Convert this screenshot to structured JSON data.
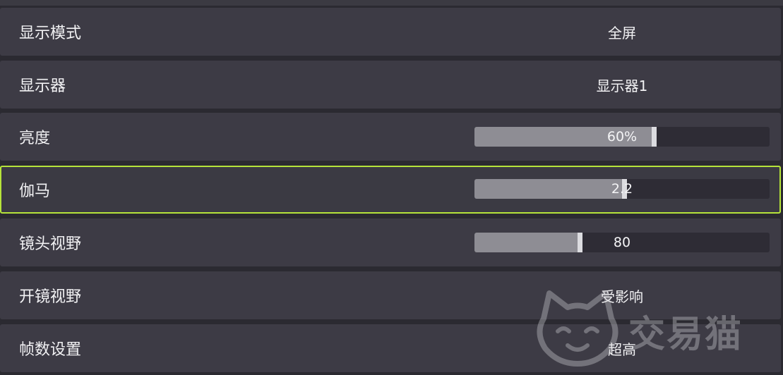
{
  "settings": [
    {
      "label": "显示模式",
      "type": "select",
      "value": "全屏"
    },
    {
      "label": "显示器",
      "type": "select",
      "value": "显示器1"
    },
    {
      "label": "亮度",
      "type": "slider",
      "value": "60%",
      "fraction": 0.6
    },
    {
      "label": "伽马",
      "type": "slider",
      "value": "2.2",
      "fraction": 0.5,
      "selected": true
    },
    {
      "label": "镜头视野",
      "type": "slider",
      "value": "80",
      "fraction": 0.35
    },
    {
      "label": "开镜视野",
      "type": "select",
      "value": "受影响"
    },
    {
      "label": "帧数设置",
      "type": "select",
      "value": "超高"
    }
  ],
  "watermark": {
    "text": "交易猫",
    "icon": "cat-face-logo"
  },
  "colors": {
    "selected_border": "#b6e43a",
    "row_bg": "#3d3b45",
    "page_bg": "#2b2a31"
  }
}
